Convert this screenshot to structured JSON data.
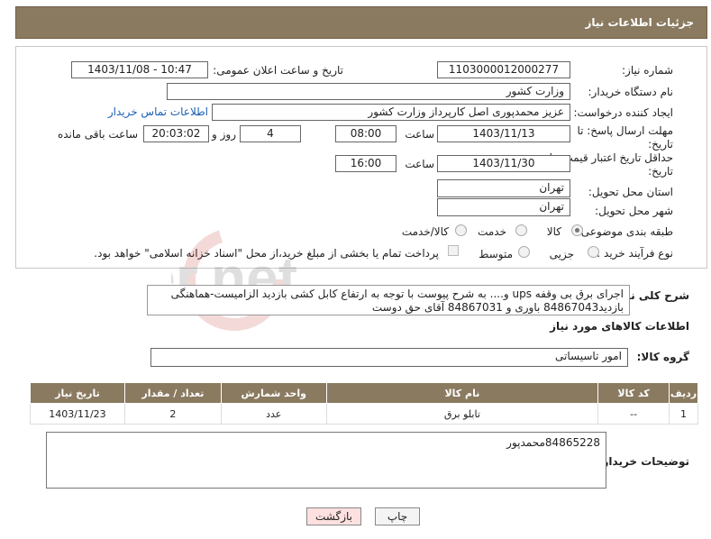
{
  "header": {
    "title": "جزئیات اطلاعات نیاز"
  },
  "form": {
    "need_number_label": "شماره نیاز:",
    "need_number": "1103000012000277",
    "announce_label": "تاریخ و ساعت اعلان عمومی:",
    "announce_value": "1403/11/08 - 10:47",
    "buyer_org_label": "نام دستگاه خریدار:",
    "buyer_org": "وزارت کشور",
    "creator_label": "ایجاد کننده درخواست:",
    "creator": "عزیز محمدپوری اصل کارپرداز وزارت کشور",
    "contact_link": "اطلاعات تماس خریدار",
    "deadline_label_1": "مهلت ارسال پاسخ: تا",
    "deadline_label_2": "تاریخ:",
    "deadline_date": "1403/11/13",
    "time_label": "ساعت",
    "deadline_time": "08:00",
    "days_value": "4",
    "days_label": "روز و",
    "remaining_time": "20:03:02",
    "remaining_label": "ساعت باقی مانده",
    "validity_label_1": "حداقل تاریخ اعتبار قیمت: تا",
    "validity_label_2": "تاریخ:",
    "validity_date": "1403/11/30",
    "validity_time_label": "ساعت",
    "validity_time": "16:00",
    "province_label": "استان محل تحویل:",
    "province": "تهران",
    "city_label": "شهر محل تحویل:",
    "city": "تهران",
    "category_label": "طبقه بندی موضوعی:",
    "category_options": [
      "کالا",
      "خدمت",
      "کالا/خدمت"
    ],
    "process_label": "نوع فرآیند خرید :",
    "process_options": [
      "جزیی",
      "متوسط"
    ],
    "payment_note": "پرداخت تمام یا بخشی از مبلغ خرید،از محل \"اسناد خزانه اسلامی\" خواهد بود."
  },
  "description": {
    "label": "شرح کلی نیاز:",
    "text": "اجرای برق بی وقفه ups و.... به شرح پیوست با توجه به ارتفاع  کابل کشی بازدید الزامیست-هماهنگی بازدید84867043 باوری و 84867031 آقای حق دوست"
  },
  "goods_section": {
    "title": "اطلاعات کالاهای مورد نیاز",
    "group_label": "گروه کالا:",
    "group_value": "امور تاسیساتی"
  },
  "table": {
    "headers": [
      "ردیف",
      "کد کالا",
      "نام کالا",
      "واحد شمارش",
      "تعداد / مقدار",
      "تاریخ نیاز"
    ],
    "rows": [
      [
        "1",
        "--",
        "تابلو برق",
        "عدد",
        "2",
        "1403/11/23"
      ]
    ]
  },
  "buyer_notes": {
    "label": "توضیحات خریدار:",
    "text": "84865228محمدپور"
  },
  "buttons": {
    "print": "چاپ",
    "back": "بازگشت"
  },
  "watermark": {
    "text": "AriaTender.net"
  },
  "colors": {
    "header_bg": "#8a7a60",
    "link": "#1a5fb4",
    "back_button_bg": "#fde0e0"
  }
}
